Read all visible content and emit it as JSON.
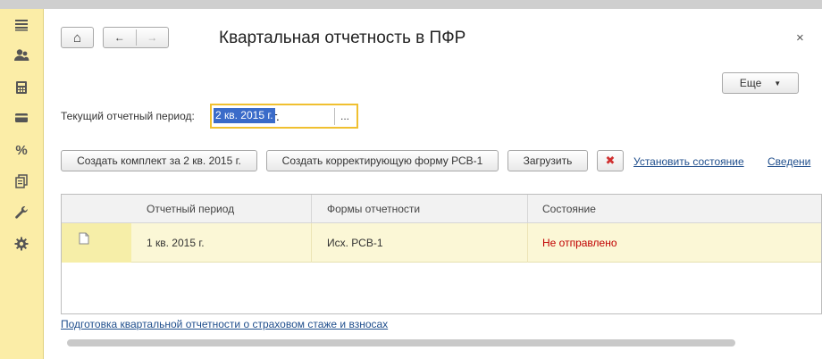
{
  "window": {
    "title": "Квартальная отчетность в ПФР",
    "close_glyph": "×"
  },
  "sidebar": {
    "items": [
      {
        "icon": "menu-icon",
        "glyph": "≡"
      },
      {
        "icon": "users-icon",
        "glyph": ""
      },
      {
        "icon": "calculator-icon",
        "glyph": ""
      },
      {
        "icon": "wallet-icon",
        "glyph": ""
      },
      {
        "icon": "percent-icon",
        "glyph": "%"
      },
      {
        "icon": "documents-icon",
        "glyph": ""
      },
      {
        "icon": "wrench-icon",
        "glyph": ""
      },
      {
        "icon": "gear-icon",
        "glyph": ""
      }
    ]
  },
  "nav": {
    "home_glyph": "⌂",
    "back_glyph": "←",
    "forward_glyph": "→"
  },
  "more_button": {
    "label": "Еще",
    "arrow": "▼"
  },
  "period": {
    "label": "Текущий отчетный период:",
    "value": "2 кв. 2015 г.",
    "select_glyph": "..."
  },
  "toolbar": {
    "create_set": "Создать комплект за 2 кв. 2015 г.",
    "create_correction": "Создать корректирующую форму РСВ-1",
    "load": "Загрузить",
    "delete_glyph": "✖",
    "set_status_link": "Установить состояние",
    "info_link": "Сведени"
  },
  "table": {
    "columns": [
      "Отчетный период",
      "Формы отчетности",
      "Состояние"
    ],
    "rows": [
      {
        "period": "1 кв. 2015 г.",
        "form": "Исх. РСВ-1",
        "status": "Не отправлено"
      }
    ]
  },
  "colors": {
    "sidebar_bg": "#fbeda7",
    "focus_border": "#f0c030",
    "link": "#1f4e8c",
    "status_not_sent": "#c00000",
    "delete_red": "#d03030"
  },
  "footer": {
    "link": "Подготовка квартальной отчетности о страховом стаже и взносах"
  }
}
